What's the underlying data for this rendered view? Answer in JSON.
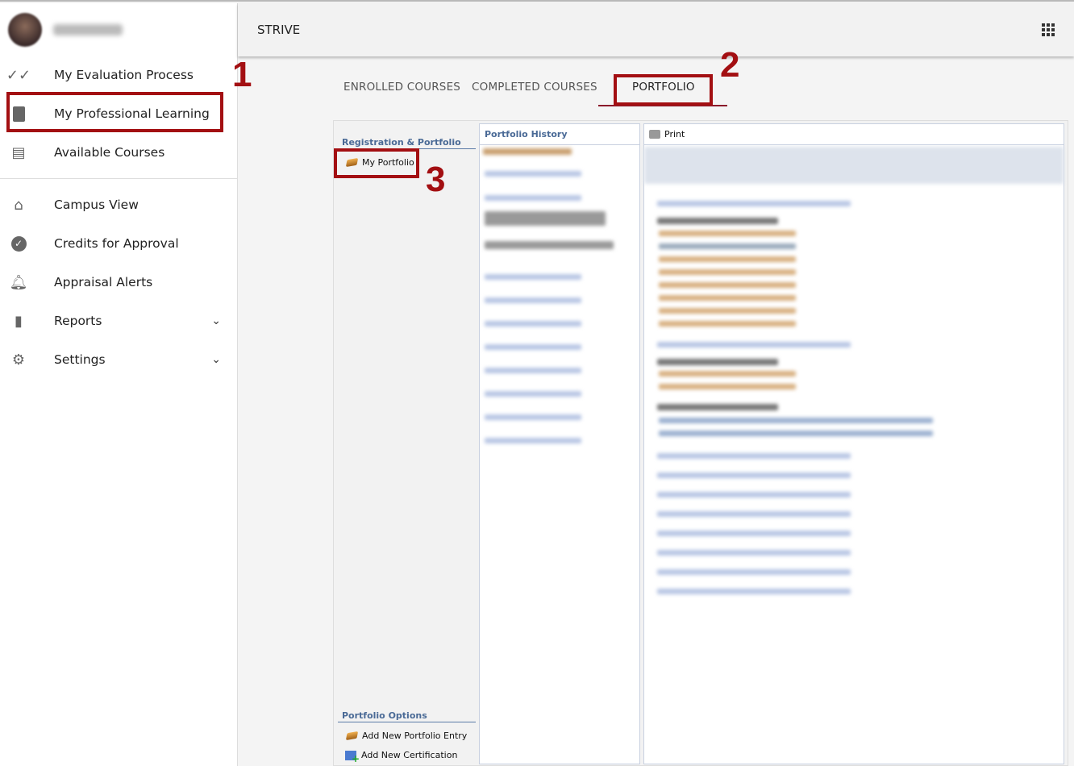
{
  "sidebar": {
    "items": [
      {
        "label": "My Evaluation Process",
        "icon": "double-check-icon"
      },
      {
        "label": "My Professional Learning",
        "icon": "book-icon"
      },
      {
        "label": "Available Courses",
        "icon": "library-icon"
      },
      {
        "label": "Campus View",
        "icon": "home-icon"
      },
      {
        "label": "Credits for Approval",
        "icon": "check-circle-icon"
      },
      {
        "label": "Appraisal Alerts",
        "icon": "alert-bell-icon"
      },
      {
        "label": "Reports",
        "icon": "bar-chart-icon"
      },
      {
        "label": "Settings",
        "icon": "gear-icon"
      }
    ]
  },
  "header": {
    "title": "STRIVE"
  },
  "tabs": [
    {
      "label": "ENROLLED COURSES"
    },
    {
      "label": "COMPLETED COURSES"
    },
    {
      "label": "PORTFOLIO",
      "active": true
    }
  ],
  "left_panel": {
    "section1": "Registration & Portfolio",
    "my_portfolio": "My Portfolio",
    "section2": "Portfolio Options",
    "add_entry": "Add New Portfolio Entry",
    "add_cert": "Add New Certification"
  },
  "history": {
    "title": "Portfolio History"
  },
  "detail": {
    "print": "Print"
  },
  "annotations": [
    "1",
    "2",
    "3"
  ],
  "colors": {
    "highlight": "#a30f12",
    "section": "#4a6a96"
  }
}
